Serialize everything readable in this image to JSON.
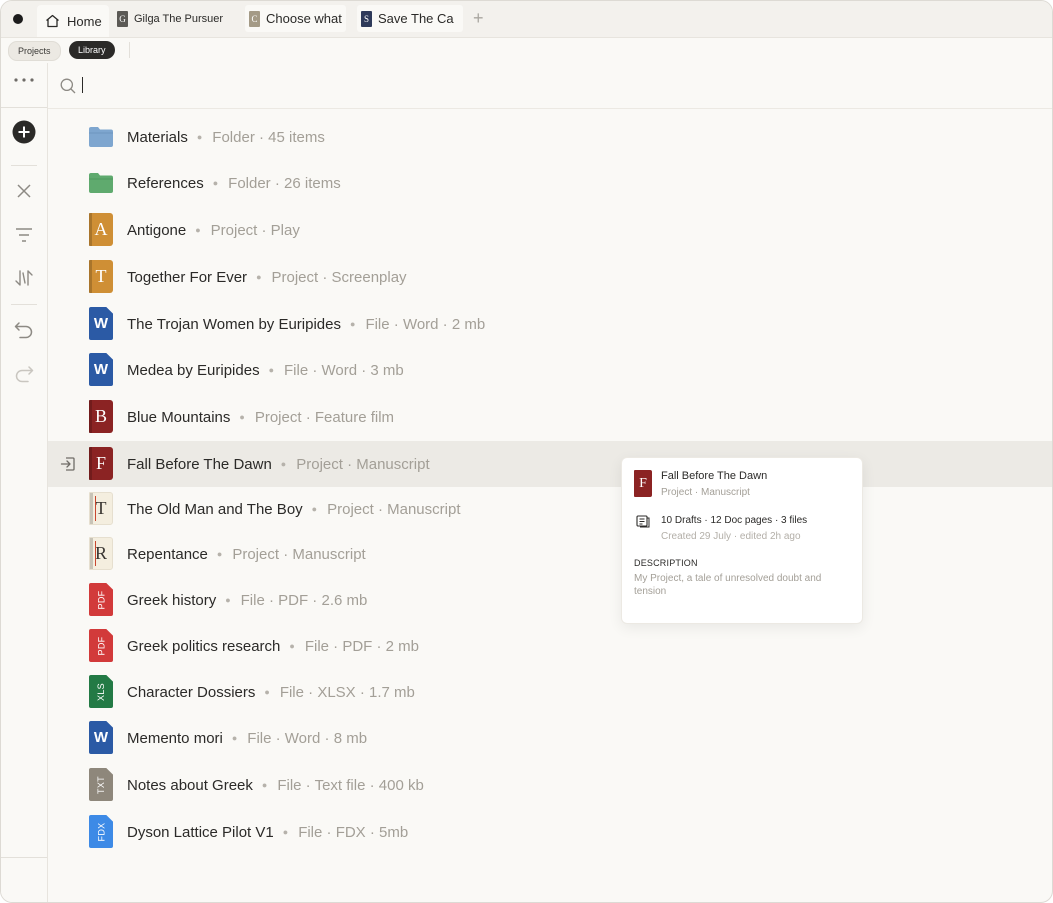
{
  "tabs": [
    {
      "label": "Home",
      "icon": "home-icon"
    },
    {
      "label": "Gilga The Pursuer",
      "icon_letter": "G",
      "icon_color": "#5b5955"
    },
    {
      "label": "Choose what",
      "icon_letter": "C",
      "icon_color": "#a49a86"
    },
    {
      "label": "Save The Ca",
      "icon_letter": "S",
      "icon_color": "#2f3a5a"
    }
  ],
  "subnav": {
    "projects": "Projects",
    "library": "Library"
  },
  "search": {
    "value": "",
    "placeholder": ""
  },
  "items": [
    {
      "name": "Materials",
      "meta": "Folder · 45 items",
      "icon": "folder",
      "color": "#7ea6cf"
    },
    {
      "name": "References",
      "meta": "Folder · 26 items",
      "icon": "folder",
      "color": "#5faa6e"
    },
    {
      "name": "Antigone",
      "meta": "Project · Play",
      "icon": "book",
      "letter": "A",
      "color": "#cf8f35"
    },
    {
      "name": "Together For Ever",
      "meta": "Project · Screenplay",
      "icon": "book",
      "letter": "T",
      "color": "#cf8f35"
    },
    {
      "name": "The Trojan Women by Euripides",
      "meta": "File · Word · 2 mb",
      "icon": "file",
      "letter": "W",
      "color": "#2b5aa5"
    },
    {
      "name": "Medea by Euripides",
      "meta": "File · Word · 3 mb",
      "icon": "file",
      "letter": "W",
      "color": "#2b5aa5"
    },
    {
      "name": "Blue Mountains",
      "meta": "Project · Feature film",
      "icon": "book",
      "letter": "B",
      "color": "#8b2323"
    },
    {
      "name": "Fall Before The Dawn",
      "meta": "Project · Manuscript",
      "icon": "book",
      "letter": "F",
      "color": "#8b2323",
      "selected": true
    },
    {
      "name": "The Old Man and The Boy",
      "meta": "Project · Manuscript",
      "icon": "paper",
      "letter": "T",
      "color": "#f4eedf"
    },
    {
      "name": "Repentance",
      "meta": "Project · Manuscript",
      "icon": "paper",
      "letter": "R",
      "color": "#f4eedf"
    },
    {
      "name": "Greek history",
      "meta": "File · PDF · 2.6 mb",
      "icon": "vfile",
      "letter": "PDF",
      "color": "#d23a3a"
    },
    {
      "name": "Greek politics research",
      "meta": "File · PDF · 2 mb",
      "icon": "vfile",
      "letter": "PDF",
      "color": "#d23a3a"
    },
    {
      "name": "Character Dossiers",
      "meta": "File · XLSX · 1.7 mb",
      "icon": "vfile",
      "letter": "XLS",
      "color": "#237a45"
    },
    {
      "name": "Memento mori",
      "meta": "File · Word · 8 mb",
      "icon": "file",
      "letter": "W",
      "color": "#2b5aa5"
    },
    {
      "name": "Notes about Greek",
      "meta": "File · Text file · 400 kb",
      "icon": "vfile",
      "letter": "TXT",
      "color": "#8e877b"
    },
    {
      "name": "Dyson Lattice Pilot V1",
      "meta": "File · FDX · 5mb",
      "icon": "vfile",
      "letter": "FDX",
      "color": "#3d8ae6"
    }
  ],
  "popup": {
    "letter": "F",
    "title": "Fall Before The Dawn",
    "subtitle": "Project · Manuscript",
    "stats": "10 Drafts · 12 Doc pages · 3 files",
    "dates": "Created 29 July · edited 2h ago",
    "desc_label": "DESCRIPTION",
    "description": "My Project, a tale of unresolved doubt and tension"
  }
}
